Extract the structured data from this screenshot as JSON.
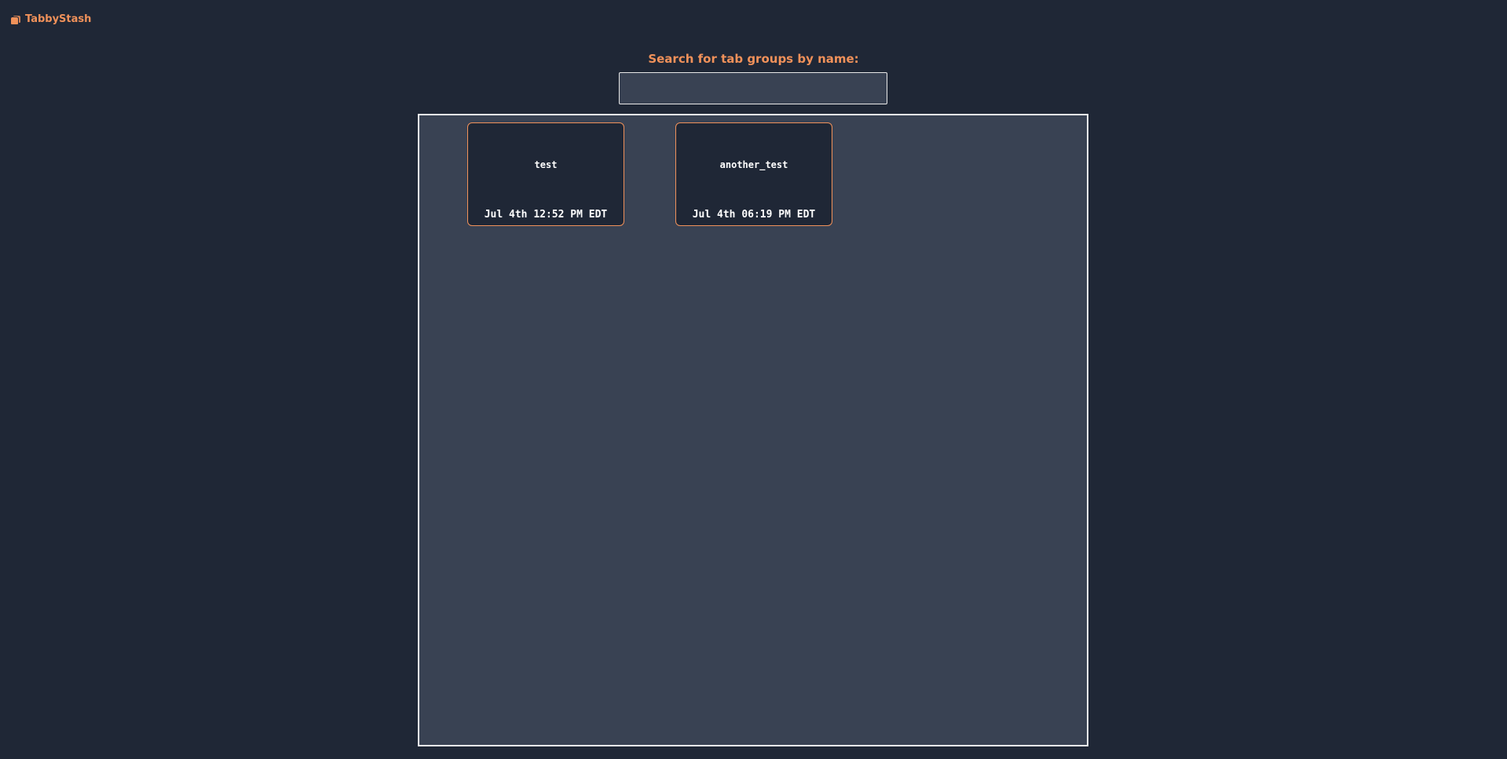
{
  "app": {
    "title": "TabbyStash",
    "logo_icon": "stacked-tabs-icon"
  },
  "search": {
    "label": "Search for tab groups by name:",
    "value": "",
    "placeholder": ""
  },
  "tab_groups": [
    {
      "name": "test",
      "date": "Jul 4th 12:52 PM EDT"
    },
    {
      "name": "another_test",
      "date": "Jul 4th 06:19 PM EDT"
    }
  ],
  "colors": {
    "background": "#1f2736",
    "panel": "#394253",
    "accent": "#f0915a",
    "text": "#ffffff"
  }
}
